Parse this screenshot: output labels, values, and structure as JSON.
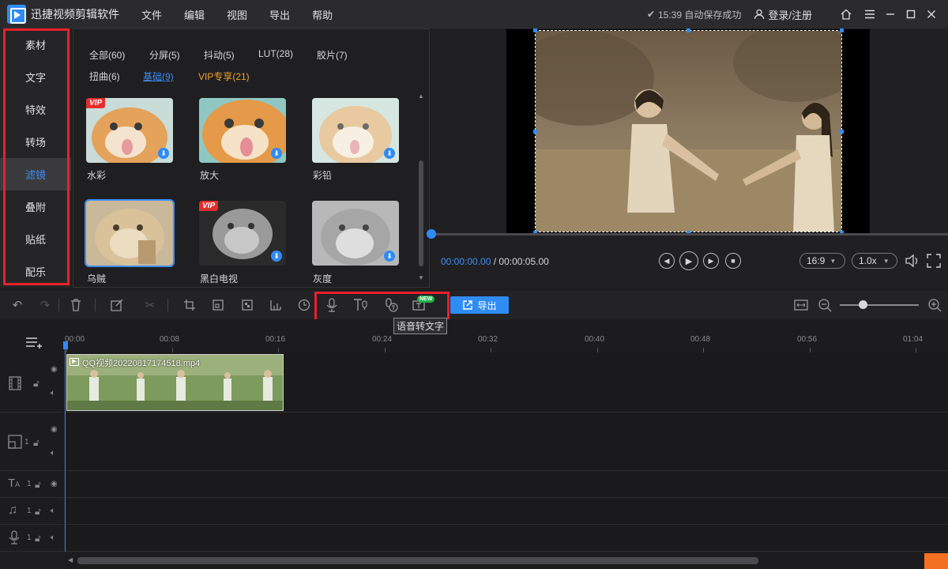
{
  "titlebar": {
    "app_title": "迅捷视频剪辑软件",
    "menu": [
      "文件",
      "编辑",
      "视图",
      "导出",
      "帮助"
    ],
    "save_status": "15:39 自动保存成功",
    "login": "登录/注册",
    "icons": [
      "home-icon",
      "menu-icon",
      "minimize-icon",
      "maximize-icon",
      "close-icon"
    ]
  },
  "categories": [
    "素材",
    "文字",
    "特效",
    "转场",
    "滤镜",
    "叠附",
    "贴纸",
    "配乐"
  ],
  "active_category": "滤镜",
  "filter_tabs": [
    "全部(60)",
    "分屏(5)",
    "抖动(5)",
    "LUT(28)",
    "胶片(7)",
    "扭曲(6)",
    "基础(9)",
    "VIP专享(21)"
  ],
  "active_filter_tab": "基础(9)",
  "filters": [
    {
      "label": "水彩",
      "vip": true
    },
    {
      "label": "放大",
      "vip": false
    },
    {
      "label": "彩铅",
      "vip": false
    },
    {
      "label": "乌贼",
      "vip": false,
      "selected": true
    },
    {
      "label": "黑白电视",
      "vip": true
    },
    {
      "label": "灰度",
      "vip": false
    }
  ],
  "vip_badge": "VIP",
  "preview": {
    "current_time": "00:00:00.00",
    "total_time": "/ 00:00:05.00",
    "aspect": "16:9",
    "speed": "1.0x"
  },
  "toolbar": {
    "export_label": "导出",
    "new_badge": "NEW",
    "tooltip": "语音转文字"
  },
  "timeline": {
    "ruler": [
      "00:00",
      "00:08",
      "00:16",
      "00:24",
      "00:32",
      "00:40",
      "00:48",
      "00:56",
      "01:04"
    ],
    "clip_name": "QQ视频20220817174518.mp4",
    "track_number": "1"
  }
}
